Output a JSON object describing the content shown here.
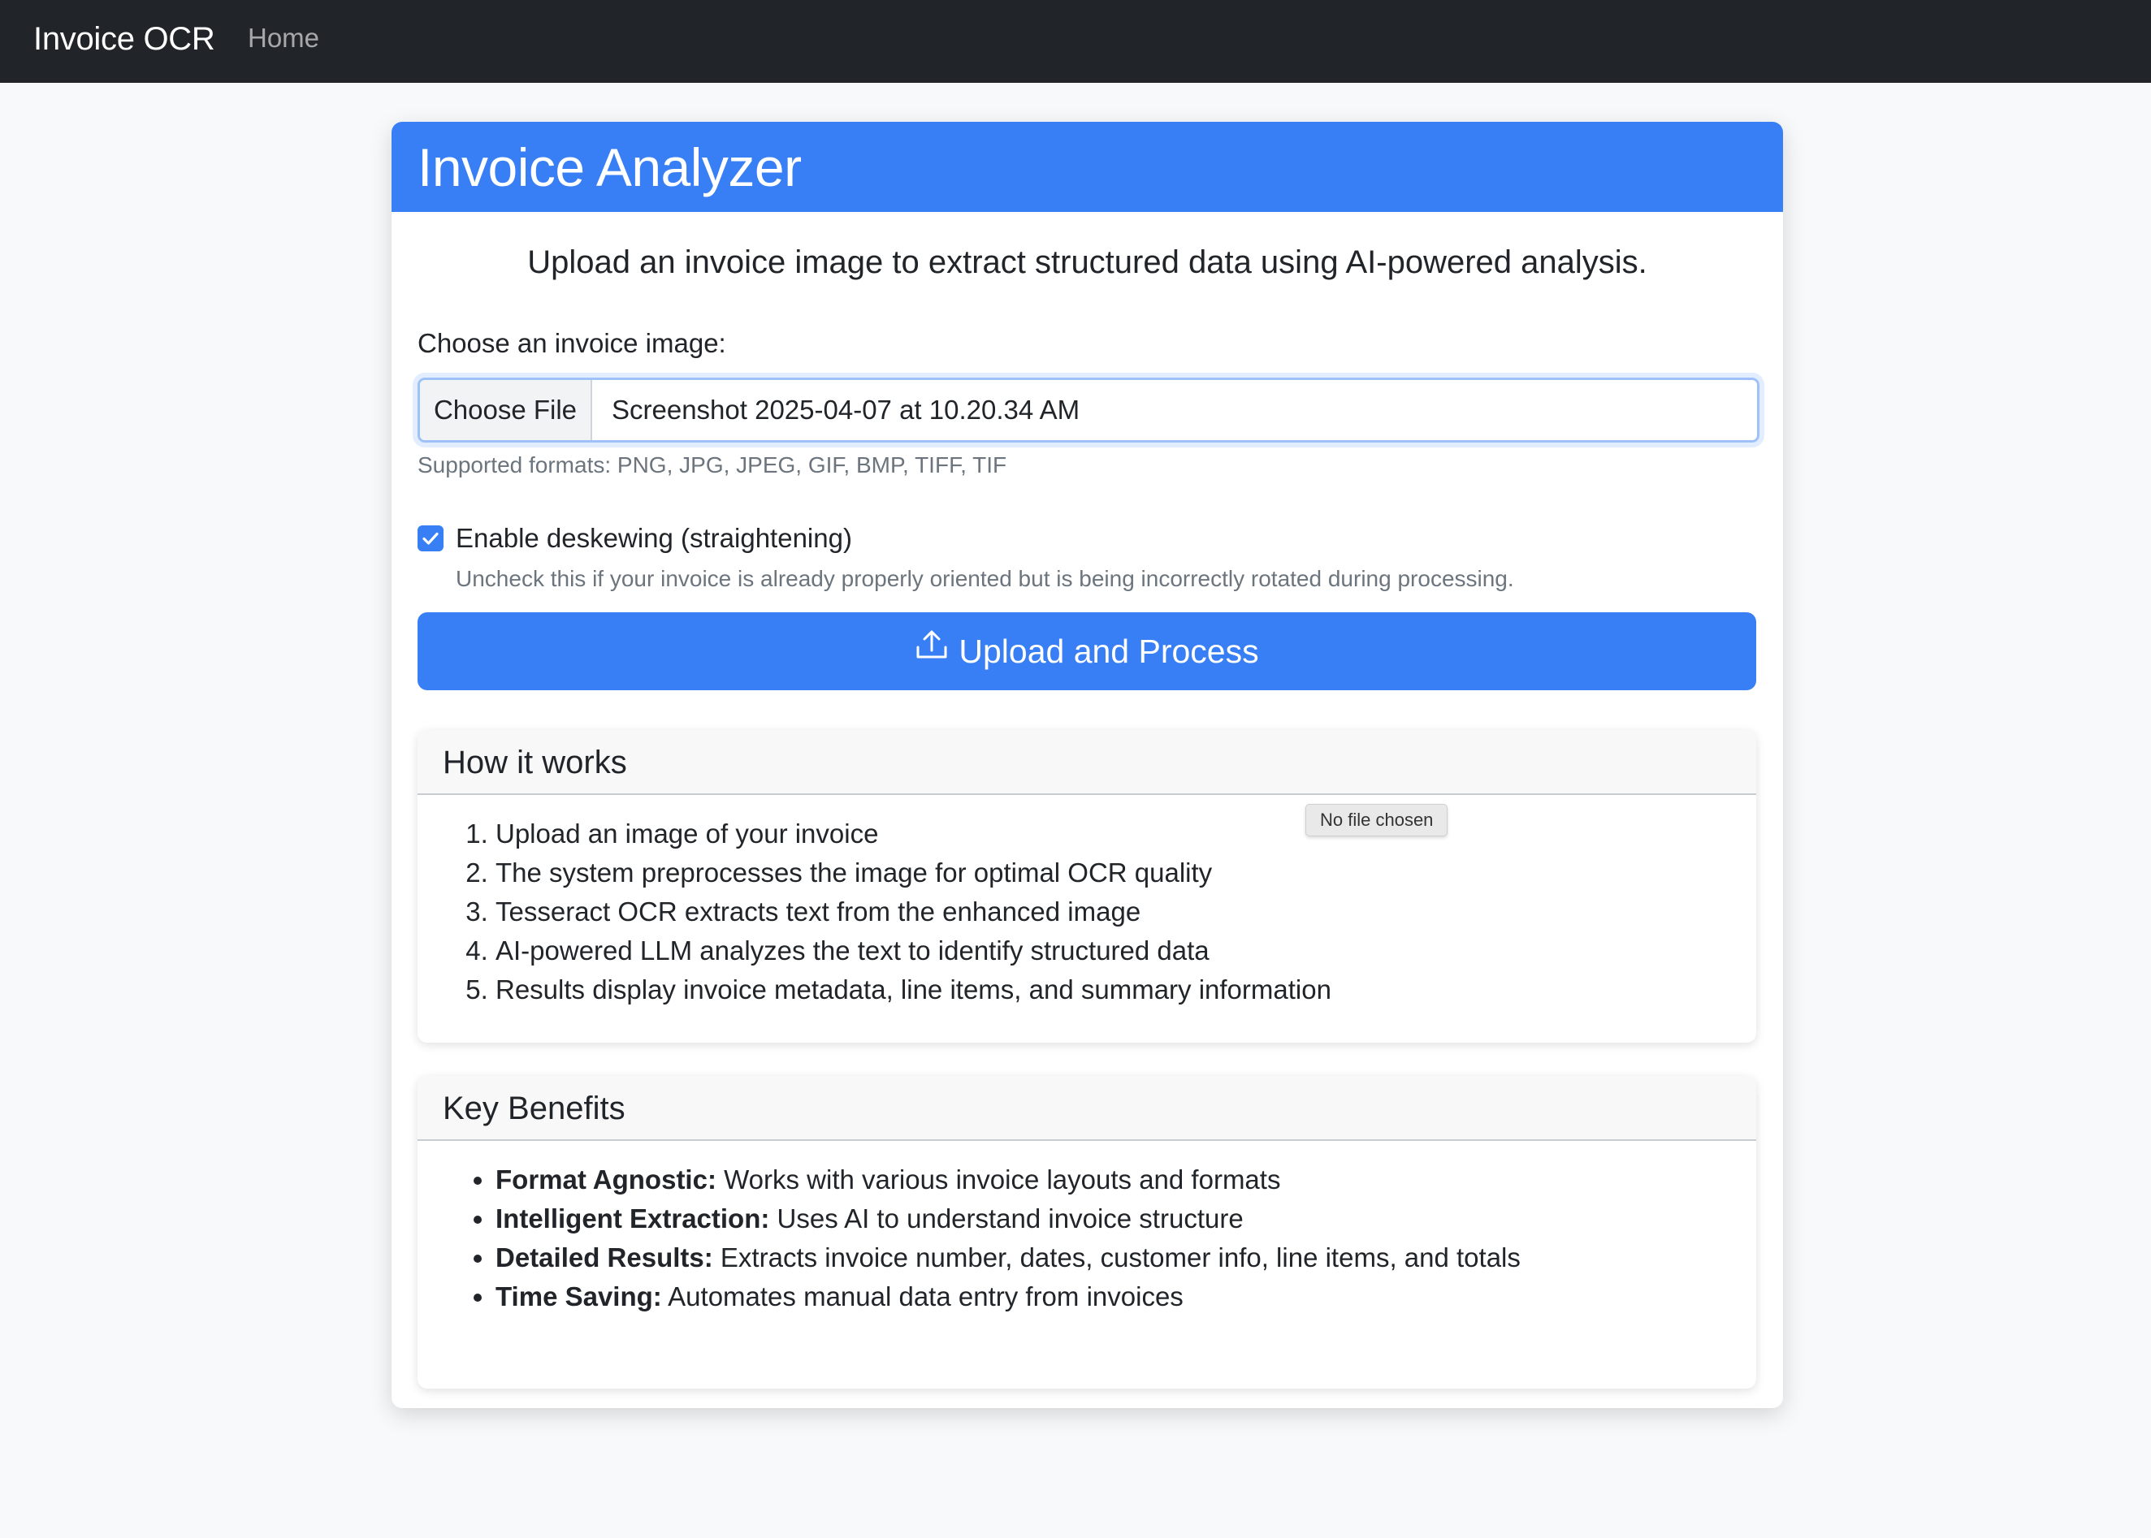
{
  "navbar": {
    "brand": "Invoice OCR",
    "home_link": "Home"
  },
  "card": {
    "title": "Invoice Analyzer",
    "lead": "Upload an invoice image to extract structured data using AI-powered analysis.",
    "file_label": "Choose an invoice image:",
    "file_button": "Choose File",
    "file_name": "Screenshot 2025-04-07 at 10.20.34 AM",
    "supported_formats": "Supported formats: PNG, JPG, JPEG, GIF, BMP, TIFF, TIF",
    "deskew": {
      "checked": true,
      "label": "Enable deskewing (straightening)",
      "help": "Uncheck this if your invoice is already properly oriented but is being incorrectly rotated during processing."
    },
    "submit_button": "Upload and Process"
  },
  "how_it_works": {
    "title": "How it works",
    "steps": [
      "Upload an image of your invoice",
      "The system preprocesses the image for optimal OCR quality",
      "Tesseract OCR extracts text from the enhanced image",
      "AI-powered LLM analyzes the text to identify structured data",
      "Results display invoice metadata, line items, and summary information"
    ]
  },
  "key_benefits": {
    "title": "Key Benefits",
    "items": [
      {
        "term": "Format Agnostic:",
        "text": "Works with various invoice layouts and formats"
      },
      {
        "term": "Intelligent Extraction:",
        "text": "Uses AI to understand invoice structure"
      },
      {
        "term": "Detailed Results:",
        "text": "Extracts invoice number, dates, customer info, line items, and totals"
      },
      {
        "term": "Time Saving:",
        "text": "Automates manual data entry from invoices"
      }
    ]
  },
  "tooltip": "No file chosen",
  "colors": {
    "navbar_bg": "#212529",
    "primary": "#387ef5",
    "page_bg": "#f8f9fa"
  }
}
